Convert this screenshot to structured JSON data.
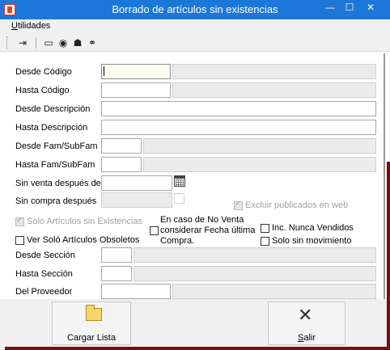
{
  "window": {
    "title": "Borrado de artículos sin existencias",
    "minimize_glyph": "—",
    "maximize_glyph": "☐",
    "close_glyph": "✕",
    "accent": "#1c77d9",
    "app_icon": "document-icon"
  },
  "menu": {
    "utilidades": "Utilidades"
  },
  "toolbar": {
    "icons": [
      "exit-door-icon",
      "page-icon",
      "eye-icon",
      "users-icon",
      "binoculars-icon"
    ],
    "glyphs": [
      "⇥",
      "▭",
      "◉",
      "☗",
      "⚭"
    ]
  },
  "form": {
    "desde_codigo": {
      "label": "Desde Código",
      "value": ""
    },
    "hasta_codigo": {
      "label": "Hasta Código",
      "value": ""
    },
    "desde_descripcion": {
      "label": "Desde Descripción",
      "value": ""
    },
    "hasta_descripcion": {
      "label": "Hasta Descripción",
      "value": ""
    },
    "desde_fam": {
      "label": "Desde Fam/SubFam",
      "value": ""
    },
    "hasta_fam": {
      "label": "Hasta Fam/SubFam",
      "value": ""
    },
    "sin_venta": {
      "label": "Sin venta después de",
      "value": ""
    },
    "sin_compra": {
      "label": "Sin compra después",
      "value": ""
    },
    "excluir_publicados": {
      "label": "Excluir publicados en web",
      "checked": true,
      "enabled": false
    },
    "solo_sin_existencias": {
      "label": "Solo Artículos sin Existencias",
      "checked": true,
      "enabled": false
    },
    "no_venta": {
      "label": "En caso de No Venta considerar Fecha última Compra.",
      "line1": "En caso de No Venta",
      "line2": "considerar Fecha última",
      "line3": "Compra.",
      "checked": false
    },
    "inc_nunca_vendidos": {
      "label": "Inc. Nunca Vendidos",
      "checked": false
    },
    "ver_obsoletos": {
      "label": "Ver Soló Artículos Obsoletos",
      "checked": false
    },
    "solo_sin_movimiento": {
      "label": "Solo sin movimiento",
      "checked": false
    },
    "desde_seccion": {
      "label": "Desde Sección",
      "value": ""
    },
    "hasta_seccion": {
      "label": "Hasta Sección",
      "value": ""
    },
    "del_proveedor": {
      "label": "Del Proveedor",
      "value": ""
    }
  },
  "buttons": {
    "cargar_lista": {
      "label": "Cargar Lista",
      "icon": "folder-icon"
    },
    "salir": {
      "label": "Salir",
      "icon": "close-icon",
      "glyph": "✕"
    }
  }
}
